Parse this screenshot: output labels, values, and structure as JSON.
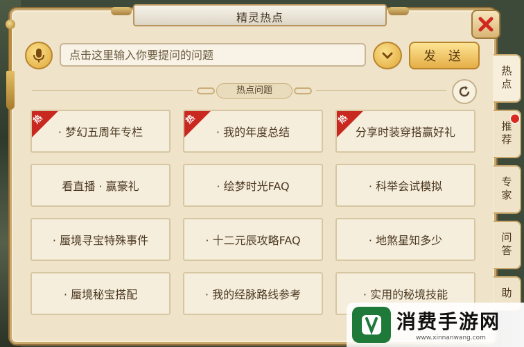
{
  "window": {
    "title": "精灵热点"
  },
  "search": {
    "placeholder": "点击这里输入你要提问的问题",
    "send_label": "发 送"
  },
  "section": {
    "title": "热点问题"
  },
  "badge": {
    "hot": "热"
  },
  "questions": [
    {
      "label": "· 梦幻五周年专栏",
      "hot": true
    },
    {
      "label": "· 我的年度总结",
      "hot": true
    },
    {
      "label": "分享时装穿搭赢好礼",
      "hot": true
    },
    {
      "label": "看直播 · 赢豪礼",
      "hot": false
    },
    {
      "label": "· 绘梦时光FAQ",
      "hot": false
    },
    {
      "label": "· 科举会试模拟",
      "hot": false
    },
    {
      "label": "· 蜃境寻宝特殊事件",
      "hot": false
    },
    {
      "label": "· 十二元辰攻略FAQ",
      "hot": false
    },
    {
      "label": "· 地煞星知多少",
      "hot": false
    },
    {
      "label": "· 蜃境秘宝搭配",
      "hot": false
    },
    {
      "label": "· 我的经脉路线参考",
      "hot": false
    },
    {
      "label": "· 实用的秘境技能",
      "hot": false
    }
  ],
  "side_tabs": [
    {
      "label": "热点",
      "active": true,
      "notification": false
    },
    {
      "label": "推荐",
      "active": false,
      "notification": true
    },
    {
      "label": "专家",
      "active": false,
      "notification": false
    },
    {
      "label": "问答",
      "active": false,
      "notification": false
    },
    {
      "label": "助",
      "active": false,
      "notification": false
    }
  ],
  "watermark": {
    "name": "消费手游网",
    "url": "www.xinnanwang.com"
  },
  "colors": {
    "hot_ribbon": "#c8281f",
    "close_x": "#d0281e",
    "accent_gold": "#e5ae46"
  }
}
